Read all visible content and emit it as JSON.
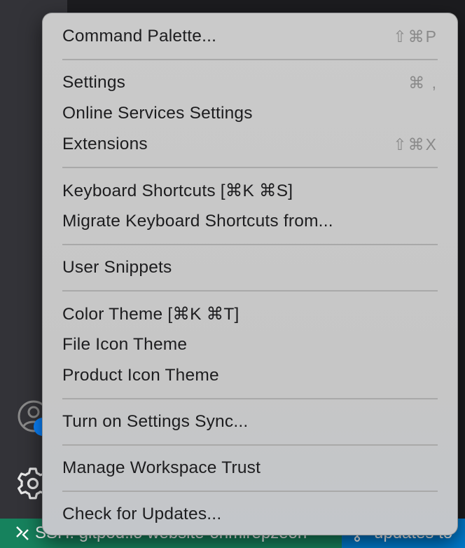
{
  "menu": {
    "groups": [
      [
        {
          "label": "Command Palette...",
          "shortcut": "⇧⌘P"
        }
      ],
      [
        {
          "label": "Settings",
          "shortcut": "⌘ ,"
        },
        {
          "label": "Online Services Settings",
          "shortcut": ""
        },
        {
          "label": "Extensions",
          "shortcut": "⇧⌘X"
        }
      ],
      [
        {
          "label": "Keyboard Shortcuts [⌘K ⌘S]",
          "shortcut": ""
        },
        {
          "label": "Migrate Keyboard Shortcuts from...",
          "shortcut": ""
        }
      ],
      [
        {
          "label": "User Snippets",
          "shortcut": ""
        }
      ],
      [
        {
          "label": "Color Theme [⌘K ⌘T]",
          "shortcut": ""
        },
        {
          "label": "File Icon Theme",
          "shortcut": ""
        },
        {
          "label": "Product Icon Theme",
          "shortcut": ""
        }
      ],
      [
        {
          "label": "Turn on Settings Sync...",
          "shortcut": ""
        }
      ],
      [
        {
          "label": "Manage Workspace Trust",
          "shortcut": ""
        }
      ],
      [
        {
          "label": "Check for Updates...",
          "shortcut": ""
        }
      ]
    ]
  },
  "status_bar": {
    "remote_label": "SSH: gitpod.io website-onmlrepzeon",
    "branch_label": "updates to"
  },
  "colors": {
    "status_bar": "#16825d",
    "branch_bg": "#007acc",
    "badge": "#0a84ff",
    "menu_bg": "#c8c8c8"
  }
}
